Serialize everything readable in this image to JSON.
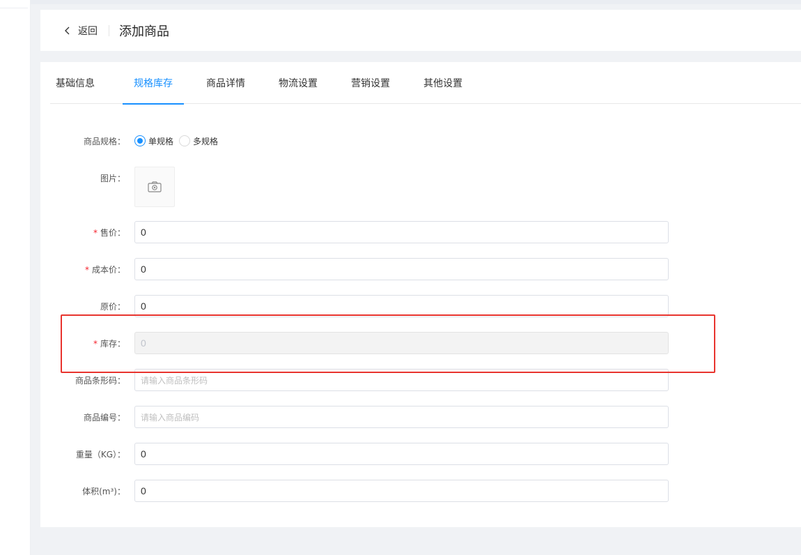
{
  "header": {
    "back_label": "返回",
    "title": "添加商品"
  },
  "tabs": [
    {
      "label": "基础信息",
      "active": false
    },
    {
      "label": "规格库存",
      "active": true
    },
    {
      "label": "商品详情",
      "active": false
    },
    {
      "label": "物流设置",
      "active": false
    },
    {
      "label": "营销设置",
      "active": false
    },
    {
      "label": "其他设置",
      "active": false
    }
  ],
  "form": {
    "spec": {
      "label": "商品规格：",
      "options": [
        "单规格",
        "多规格"
      ],
      "selected": "单规格"
    },
    "image": {
      "label": "图片：",
      "icon": "camera-icon"
    },
    "price": {
      "label": "售价：",
      "required": "*",
      "value": "0"
    },
    "cost": {
      "label": "成本价：",
      "required": "*",
      "value": "0"
    },
    "original_price": {
      "label": "原价：",
      "value": "0"
    },
    "stock": {
      "label": "库存：",
      "required": "*",
      "value": "0"
    },
    "barcode": {
      "label": "商品条形码：",
      "value": "",
      "placeholder": "请输入商品条形码"
    },
    "code": {
      "label": "商品编号：",
      "value": "",
      "placeholder": "请输入商品编码"
    },
    "weight": {
      "label": "重量（KG）：",
      "value": "0"
    },
    "volume": {
      "label": "体积(m³)：",
      "value": "0"
    }
  },
  "colors": {
    "accent": "#1890ff",
    "required": "#f5222d",
    "highlight": "#e8342e"
  }
}
